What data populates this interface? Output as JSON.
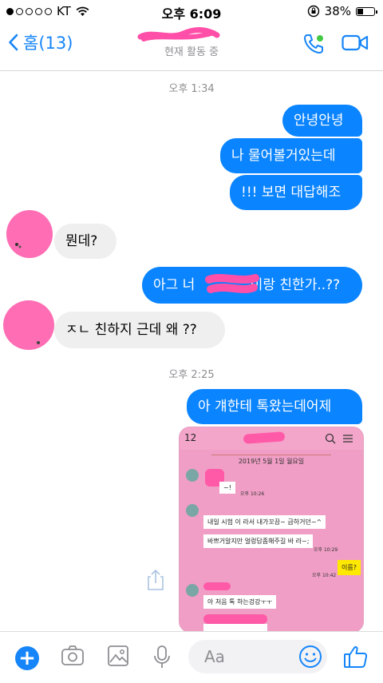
{
  "status_bar": {
    "carrier": "KT",
    "time": "오후 6:09",
    "battery": "38%",
    "battery_level": 0.38
  },
  "header": {
    "back_label": "홈(13)",
    "status": "현재 활동 중"
  },
  "timestamps": [
    "오후 1:34",
    "오후 2:25"
  ],
  "messages": [
    {
      "text": "안녕안녕"
    },
    {
      "text": "나 물어볼거있는데"
    },
    {
      "text": "!!! 보면 대답해조"
    },
    {
      "text": "뭔데?"
    },
    {
      "text_a": "아그 너 ",
      "text_b": "이랑 친한가..??"
    },
    {
      "text": "ㅈㄴ 친하지 근데 왜 ??"
    },
    {
      "text": "아 걔한테 톡왔는데어제"
    }
  ],
  "shared_image": {
    "back_label": "12",
    "date": "2019년 5월 1일 월요일",
    "lines": [
      {
        "text": "~!"
      },
      {
        "text": "내일 시험 이 라서 내가꼬끔~ 급하거던~^"
      },
      {
        "text": "바쁘거알지만 얼렁답좀해주길 바 라~;"
      },
      {
        "text": "이름?"
      },
      {
        "text": "아 처음 톡 하는겅강ㅜㅜ"
      }
    ],
    "times": [
      "오후 10:26",
      "오후 10:29",
      "오후 10:42"
    ]
  },
  "composer": {
    "placeholder": "Aa"
  },
  "colors": {
    "accent": "#1685f9",
    "outgoing_bubble": "#0a84ff",
    "incoming_bubble": "#efefef",
    "redaction": "#ff6eb4"
  }
}
